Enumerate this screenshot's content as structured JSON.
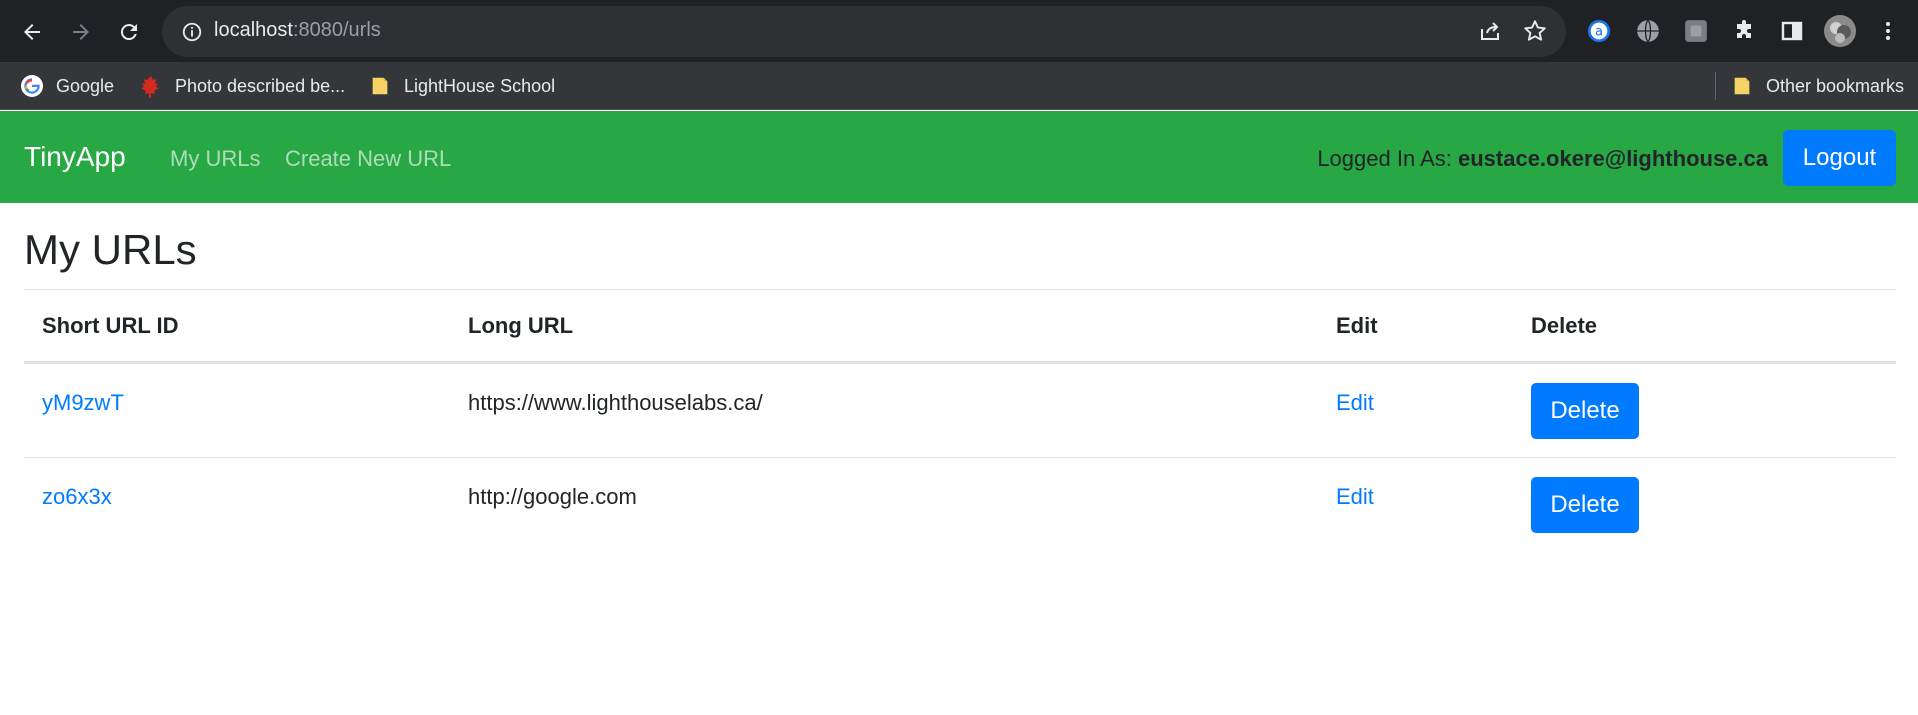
{
  "browser": {
    "url_host": "localhost",
    "url_path": ":8080/urls",
    "bookmarks": [
      {
        "label": "Google",
        "icon": "google-icon"
      },
      {
        "label": "Photo described be...",
        "icon": "maple-leaf-icon"
      },
      {
        "label": "LightHouse School",
        "icon": "folder-icon"
      }
    ],
    "other_bookmarks": "Other bookmarks"
  },
  "navbar": {
    "brand": "TinyApp",
    "links": [
      "My URLs",
      "Create New URL"
    ],
    "logged_in_label": "Logged In As: ",
    "email": "eustace.okere@lighthouse.ca",
    "logout": "Logout",
    "color": "#28a745"
  },
  "page": {
    "title": "My URLs",
    "columns": [
      "Short URL ID",
      "Long URL",
      "Edit",
      "Delete"
    ],
    "rows": [
      {
        "short_id": "yM9zwT",
        "long_url": "https://www.lighthouselabs.ca/",
        "edit": "Edit",
        "delete": "Delete"
      },
      {
        "short_id": "zo6x3x",
        "long_url": "http://google.com",
        "edit": "Edit",
        "delete": "Delete"
      }
    ]
  },
  "colors": {
    "primary": "#007bff",
    "navbar": "#28a745",
    "chrome_dark": "#202124"
  }
}
